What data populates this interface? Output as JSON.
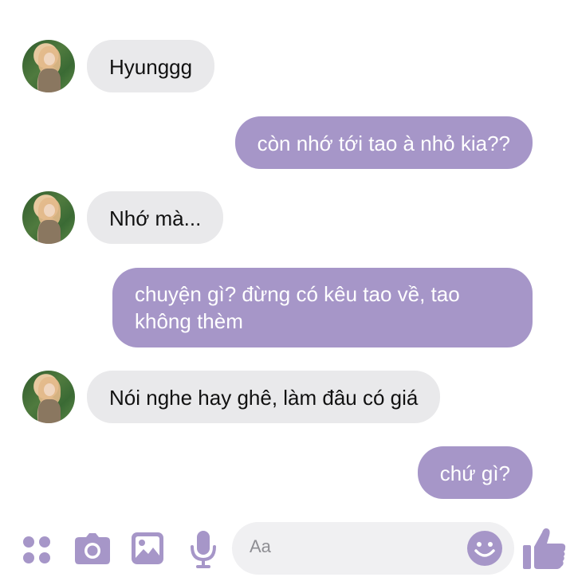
{
  "conversation": {
    "messages": [
      {
        "direction": "incoming",
        "text": "Hyunggg"
      },
      {
        "direction": "outgoing",
        "text": "còn nhớ tới tao à nhỏ kia??"
      },
      {
        "direction": "incoming",
        "text": "Nhớ mà..."
      },
      {
        "direction": "outgoing",
        "text_line1": "chuyện gì? đừng có kêu tao về, tao",
        "text_line2": "không thèm"
      },
      {
        "direction": "incoming",
        "text": "Nói nghe hay ghê, làm đâu có giá"
      },
      {
        "direction": "outgoing",
        "text": "chứ gì?"
      }
    ]
  },
  "composer": {
    "placeholder": "Aa",
    "icons": [
      "apps-icon",
      "camera-icon",
      "gallery-icon",
      "microphone-icon",
      "emoji-icon",
      "thumbs-up-icon"
    ]
  },
  "colors": {
    "accent": "#a696c8",
    "incoming_bubble": "#e9e9eb",
    "input_bg": "#f0f0f2"
  }
}
